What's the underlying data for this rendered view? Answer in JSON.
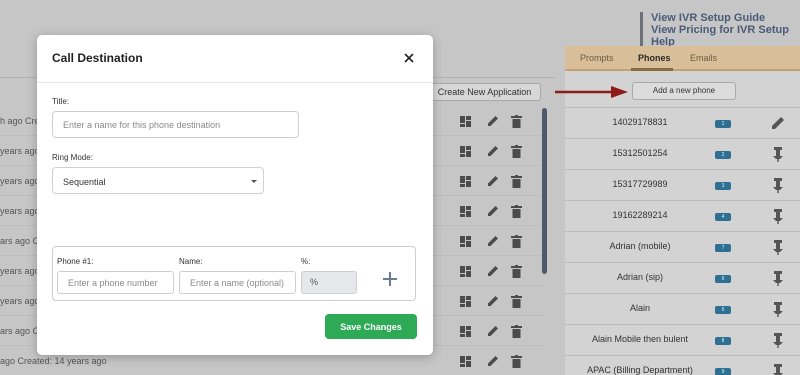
{
  "help_links": [
    "View IVR Setup Guide",
    "View Pricing for IVR Setup Help"
  ],
  "left_panel": {
    "create_app_label": "Create New Application",
    "rows": [
      {
        "age": "h ago Cre"
      },
      {
        "age": "years ago Cre"
      },
      {
        "age": "years ago Cre"
      },
      {
        "age": "years ago Cre"
      },
      {
        "age": "ars ago Cre"
      },
      {
        "age": "years ago Cre"
      },
      {
        "age": "years ago Cre"
      },
      {
        "age": "ars ago Cre"
      },
      {
        "age": "ago Created: 14 years ago"
      }
    ]
  },
  "right_panel": {
    "tabs": [
      {
        "label": "Prompts"
      },
      {
        "label": "Phones"
      },
      {
        "label": "Emails"
      }
    ],
    "active_tab": "Phones",
    "add_phone_label": "Add a new phone",
    "phones": [
      {
        "name": "14029178831",
        "badge": "1"
      },
      {
        "name": "15312501254",
        "badge": "2"
      },
      {
        "name": "15317729989",
        "badge": "3"
      },
      {
        "name": "19162289214",
        "badge": "4"
      },
      {
        "name": "Adrian (mobile)",
        "badge": "7"
      },
      {
        "name": "Adrian (sip)",
        "badge": "6"
      },
      {
        "name": "Alain",
        "badge": "5"
      },
      {
        "name": "Alain Mobile then bulent",
        "badge": "8"
      },
      {
        "name": "APAC (Billing Department)",
        "badge": "9"
      }
    ]
  },
  "modal": {
    "title": "Call Destination",
    "title_label": "Title:",
    "title_placeholder": "Enter a name for this phone destination",
    "ring_mode_label": "Ring Mode:",
    "ring_mode_value": "Sequential",
    "phone_label": "Phone #1:",
    "phone_placeholder": "Enter a phone number",
    "name_label": "Name:",
    "name_placeholder": "Enter a name (optional)",
    "pct_label": "%:",
    "pct_placeholder": "%",
    "save_label": "Save Changes"
  },
  "colors": {
    "accent_green": "#2eaa57",
    "arrow_red": "#8f1a1a",
    "tab_bar": "#d8bf9a"
  }
}
